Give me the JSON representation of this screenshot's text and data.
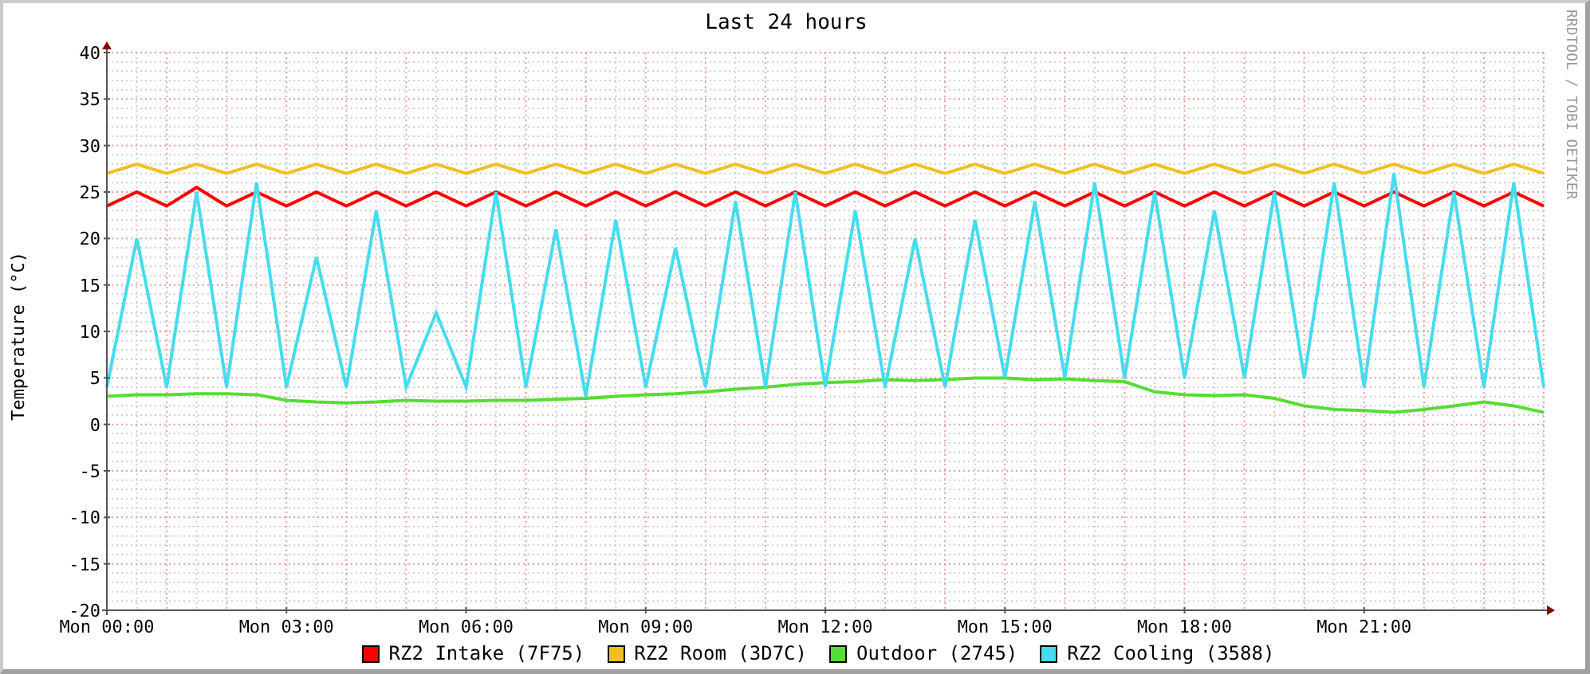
{
  "graph": {
    "side_text": "RRDTOOL / TOBI OETIKER",
    "chart_data": {
      "type": "line",
      "title": "Last 24 hours",
      "ylabel": "Temperature (°C)",
      "ylim": [
        -20,
        40
      ],
      "grid": true,
      "yticks": [
        -20,
        -15,
        -10,
        -5,
        0,
        5,
        10,
        15,
        20,
        25,
        30,
        35,
        40
      ],
      "categories": [
        "Mon 00:00",
        null,
        null,
        null,
        null,
        null,
        "Mon 03:00",
        null,
        null,
        null,
        null,
        null,
        "Mon 06:00",
        null,
        null,
        null,
        null,
        null,
        "Mon 09:00",
        null,
        null,
        null,
        null,
        null,
        "Mon 12:00",
        null,
        null,
        null,
        null,
        null,
        "Mon 15:00",
        null,
        null,
        null,
        null,
        null,
        "Mon 18:00",
        null,
        null,
        null,
        null,
        null,
        "Mon 21:00",
        null,
        null,
        null,
        null,
        null,
        null
      ],
      "series": [
        {
          "name": "RZ2 Intake (7F75)",
          "color": "#ff0000",
          "values": [
            23.5,
            25,
            23.5,
            25.5,
            23.5,
            25,
            23.5,
            25,
            23.5,
            25,
            23.5,
            25,
            23.5,
            25,
            23.5,
            25,
            23.5,
            25,
            23.5,
            25,
            23.5,
            25,
            23.5,
            25,
            23.5,
            25,
            23.5,
            25,
            23.5,
            25,
            23.5,
            25,
            23.5,
            25,
            23.5,
            25,
            23.5,
            25,
            23.5,
            25,
            23.5,
            25,
            23.5,
            25,
            23.5,
            25,
            23.5,
            25,
            23.5
          ]
        },
        {
          "name": "RZ2 Room (3D7C)",
          "color": "#f0c020",
          "values": [
            27,
            28,
            27,
            28,
            27,
            28,
            27,
            28,
            27,
            28,
            27,
            28,
            27,
            28,
            27,
            28,
            27,
            28,
            27,
            28,
            27,
            28,
            27,
            28,
            27,
            28,
            27,
            28,
            27,
            28,
            27,
            28,
            27,
            28,
            27,
            28,
            27,
            28,
            27,
            28,
            27,
            28,
            27,
            28,
            27,
            28,
            27,
            28,
            27
          ]
        },
        {
          "name": "Outdoor (2745)",
          "color": "#55dd33",
          "values": [
            3,
            3.2,
            3.2,
            3.3,
            3.3,
            3.2,
            2.6,
            2.4,
            2.3,
            2.4,
            2.6,
            2.5,
            2.5,
            2.6,
            2.6,
            2.7,
            2.8,
            3.0,
            3.2,
            3.3,
            3.5,
            3.8,
            4.0,
            4.3,
            4.5,
            4.6,
            4.8,
            4.7,
            4.8,
            5.0,
            5.0,
            4.8,
            4.9,
            4.7,
            4.6,
            3.5,
            3.2,
            3.1,
            3.2,
            2.8,
            2.0,
            1.6,
            1.5,
            1.3,
            1.6,
            2.0,
            2.4,
            2.0,
            1.3
          ]
        },
        {
          "name": "RZ2 Cooling (3588)",
          "color": "#44ddee",
          "values": [
            4,
            20,
            4,
            25,
            4,
            26,
            4,
            18,
            4,
            23,
            4,
            12,
            4,
            25,
            4,
            21,
            3,
            22,
            4,
            19,
            4,
            24,
            4,
            25,
            4,
            23,
            4,
            20,
            4,
            22,
            5,
            24,
            5,
            26,
            5,
            25,
            5,
            23,
            5,
            25,
            5,
            26,
            4,
            27,
            4,
            25,
            4,
            26,
            4
          ]
        }
      ]
    }
  }
}
